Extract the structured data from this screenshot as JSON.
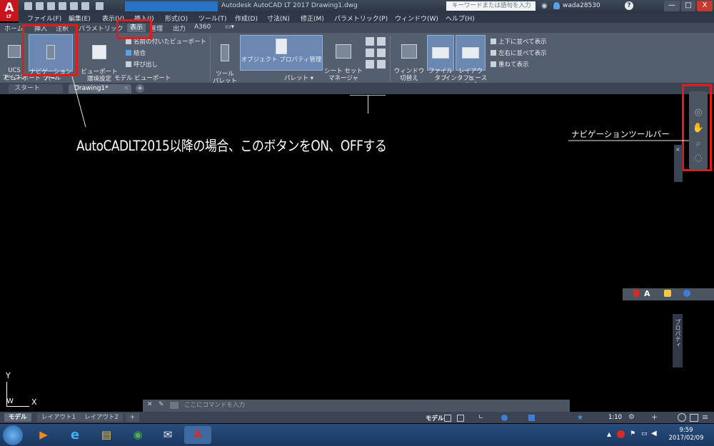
{
  "title_bar": {
    "app_logo": "A",
    "app_logo_sub": "LT",
    "title": "Autodesk AutoCAD LT 2017    Drawing1.dwg",
    "search_placeholder": "キーワードまたは語句を入力",
    "user": "wada28530",
    "window_buttons": [
      "—",
      "□",
      "X"
    ]
  },
  "menu_bar": [
    "ファイル(F)",
    "編集(E)",
    "表示(V)",
    "挿入(I)",
    "形式(O)",
    "ツール(T)",
    "作成(D)",
    "寸法(N)",
    "修正(M)",
    "パラメトリック(P)",
    "ウィンドウ(W)",
    "ヘルプ(H)"
  ],
  "ribbon_tabs": [
    "ホーム",
    "挿入",
    "注釈",
    "パラメトリック",
    "表示",
    "管理",
    "出力",
    "A360"
  ],
  "ribbon": {
    "ucs_icon": "UCS\nアイコン",
    "navigation_bar": "ナビゲーション\nバー",
    "viewport_settings": "ビューポート\n環境設定",
    "named_viewports": "名前の付いたビューポート",
    "join": "結合",
    "restore": "呼び出し",
    "tool_palette": "ツール\nパレット",
    "properties": "オブジェクト プロパティ管理",
    "sheet_set": "シート セット\nマネージャ",
    "switch_window": "ウィンドウ\n切替え",
    "file_tabs": "ファイル\nタブ",
    "layout_tabs": "レイアウト\nタブ",
    "tile_horizontal": "上下に並べて表示",
    "tile_vertical": "左右に並べて表示",
    "cascade": "重ねて表示",
    "panel_viewport_tools": "ビューポート ツール",
    "panel_model_viewports": "モデル ビューポート",
    "panel_palettes": "パレット ▾",
    "panel_interface": "インタフェース"
  },
  "doc_tabs": {
    "start": "スタート",
    "drawing": "Drawing1*",
    "close": "×",
    "add": "+"
  },
  "annotations": {
    "main": "AutoCADLT2015以降の場合、このボタンをON、OFFする",
    "navbar_label": "ナビゲーションツールバー"
  },
  "side_palettes": {
    "palette_vertical": "プロパティ"
  },
  "command_line": {
    "placeholder": "ここにコマンドを入力"
  },
  "layout_tabs": [
    "モデル",
    "レイアウト1",
    "レイアウト2",
    "+"
  ],
  "status_bar": {
    "model": "モデル",
    "scale": "1:10"
  },
  "ucs": {
    "y": "Y",
    "w": "W",
    "x": "X"
  },
  "taskbar": {
    "time": "9:59",
    "date": "2017/02/09"
  },
  "colors": {
    "highlight": "#e31b1b",
    "canvas": "#000000",
    "ribbon": "#535f6e",
    "selected_button": "#6b88b3"
  }
}
